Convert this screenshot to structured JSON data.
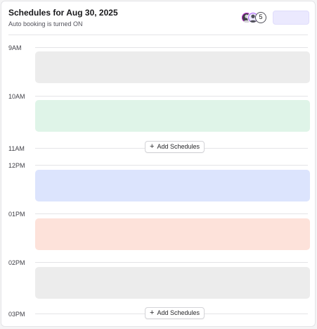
{
  "header": {
    "title": "Schedules for Aug 30, 2025",
    "subtitle": "Auto booking is turned ON",
    "avatars": {
      "count_label": "5"
    }
  },
  "timeline": {
    "times": [
      "9AM",
      "10AM",
      "11AM",
      "12PM",
      "01PM",
      "02PM",
      "03PM"
    ],
    "blocks": [
      {
        "color": "#ececec"
      },
      {
        "color": "#dff4e8"
      },
      {
        "color": "#dce4fd"
      },
      {
        "color": "#fde2da"
      },
      {
        "color": "#ececec"
      }
    ],
    "add_button_label": "Add Schedules",
    "add_icon": "plus-icon"
  }
}
